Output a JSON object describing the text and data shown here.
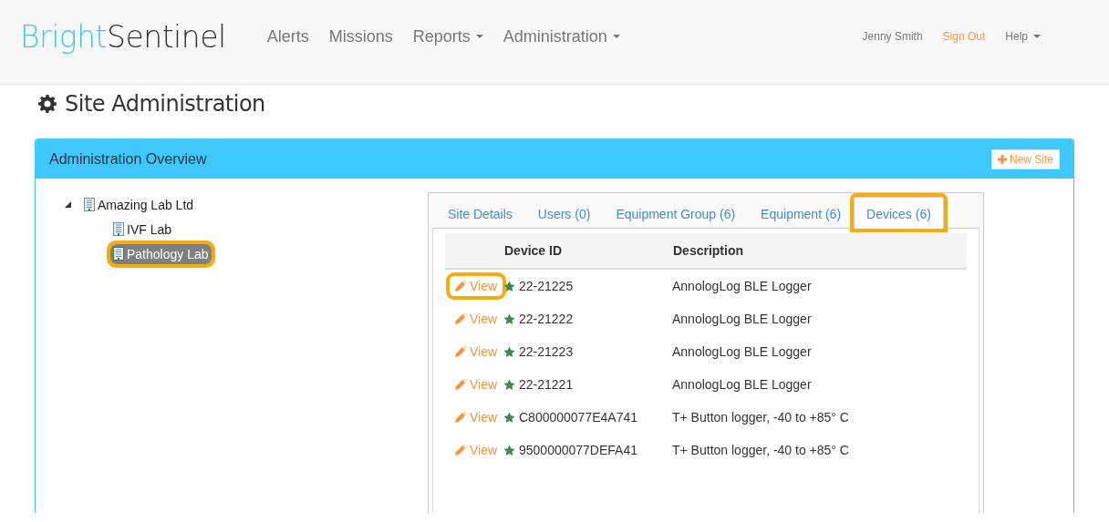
{
  "brand": {
    "part_1": "Bright",
    "part_2": "Sentinel"
  },
  "nav": [
    {
      "label": "Alerts",
      "dropdown": false
    },
    {
      "label": "Missions",
      "dropdown": false
    },
    {
      "label": "Reports",
      "dropdown": true
    },
    {
      "label": "Administration",
      "dropdown": true
    }
  ],
  "user_menu": [
    {
      "label": "Jenny Smith",
      "kind": "user",
      "dropdown": false
    },
    {
      "label": "Sign Out",
      "kind": "signout",
      "dropdown": false
    },
    {
      "label": "Help",
      "kind": "help",
      "dropdown": true
    }
  ],
  "page_title": "Site Administration",
  "panel": {
    "title": "Administration Overview",
    "new_button": "New Site"
  },
  "tree": [
    {
      "label": "Amazing Lab Ltd",
      "expanded": true,
      "selected": false,
      "highlighted": false,
      "children": [
        {
          "label": "IVF Lab",
          "selected": false,
          "highlighted": false
        },
        {
          "label": "Pathology Lab",
          "selected": true,
          "highlighted": true
        }
      ]
    }
  ],
  "tabs": [
    {
      "label": "Site Details",
      "selected": false,
      "highlighted": false
    },
    {
      "label": "Users (0)",
      "selected": false,
      "highlighted": false
    },
    {
      "label": "Equipment Group (6)",
      "selected": false,
      "highlighted": false
    },
    {
      "label": "Equipment (6)",
      "selected": false,
      "highlighted": false
    },
    {
      "label": "Devices (6)",
      "selected": true,
      "highlighted": true
    }
  ],
  "table": {
    "columns": [
      "Device ID",
      "Description"
    ],
    "rows": [
      {
        "action": "View",
        "highlighted": true,
        "device_id": "22-21225",
        "description": "AnnologLog BLE Logger"
      },
      {
        "action": "View",
        "highlighted": false,
        "device_id": "22-21222",
        "description": "AnnologLog BLE Logger"
      },
      {
        "action": "View",
        "highlighted": false,
        "device_id": "22-21223",
        "description": "AnnologLog BLE Logger"
      },
      {
        "action": "View",
        "highlighted": false,
        "device_id": "22-21221",
        "description": "AnnologLog BLE Logger"
      },
      {
        "action": "View",
        "highlighted": false,
        "device_id": "C800000077E4A741",
        "description": "T+ Button logger, -40 to +85° C"
      },
      {
        "action": "View",
        "highlighted": false,
        "device_id": "9500000077DEFA41",
        "description": "T+ Button logger, -40 to +85° C"
      }
    ]
  }
}
